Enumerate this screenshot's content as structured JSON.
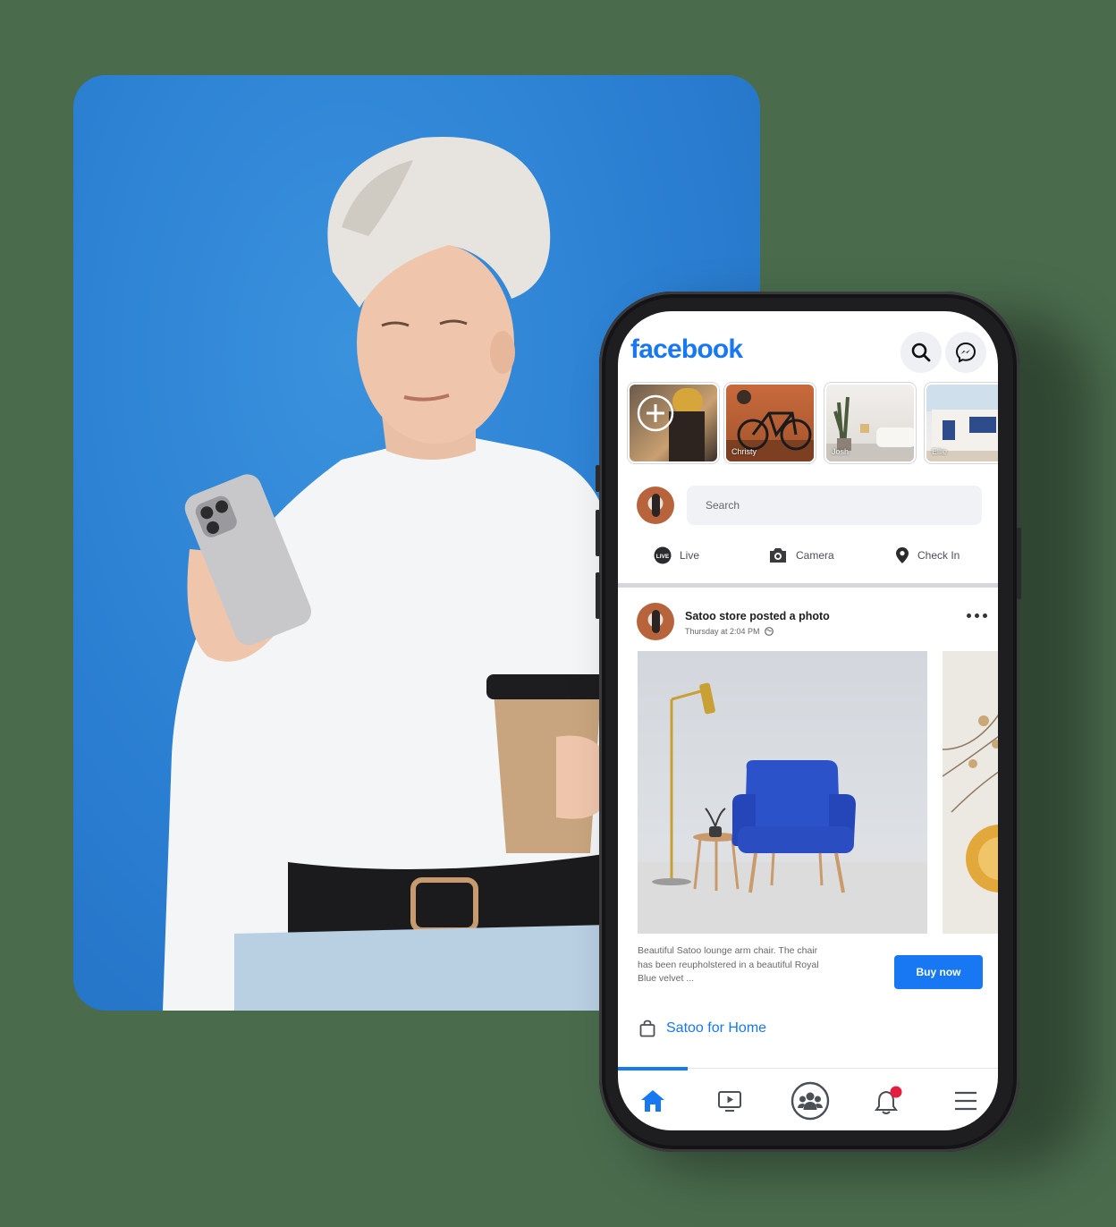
{
  "app": {
    "logo_text": "facebook",
    "brand_color": "#1877f2"
  },
  "header": {
    "search_icon": "search-icon",
    "messenger_icon": "messenger-icon"
  },
  "stories": [
    {
      "label": "",
      "is_create": true
    },
    {
      "label": "Christy"
    },
    {
      "label": "Josh"
    },
    {
      "label": "Ellie"
    }
  ],
  "composer": {
    "search_placeholder": "Search",
    "actions": {
      "live": "Live",
      "camera": "Camera",
      "checkin": "Check In"
    },
    "live_badge": "LIVE"
  },
  "post": {
    "author": "Satoo store posted a photo",
    "time": "Thursday at 2:04 PM",
    "description": "Beautiful Satoo lounge arm chair. The chair has been reupholstered in a beautiful Royal Blue velvet ...",
    "cta": "Buy now",
    "shop_link": "Satoo for Home"
  },
  "tabbar": {
    "tabs": [
      "home-icon",
      "watch-icon",
      "groups-icon",
      "notifications-icon",
      "menu-icon"
    ],
    "notification_dot_color": "#e41e3f"
  }
}
